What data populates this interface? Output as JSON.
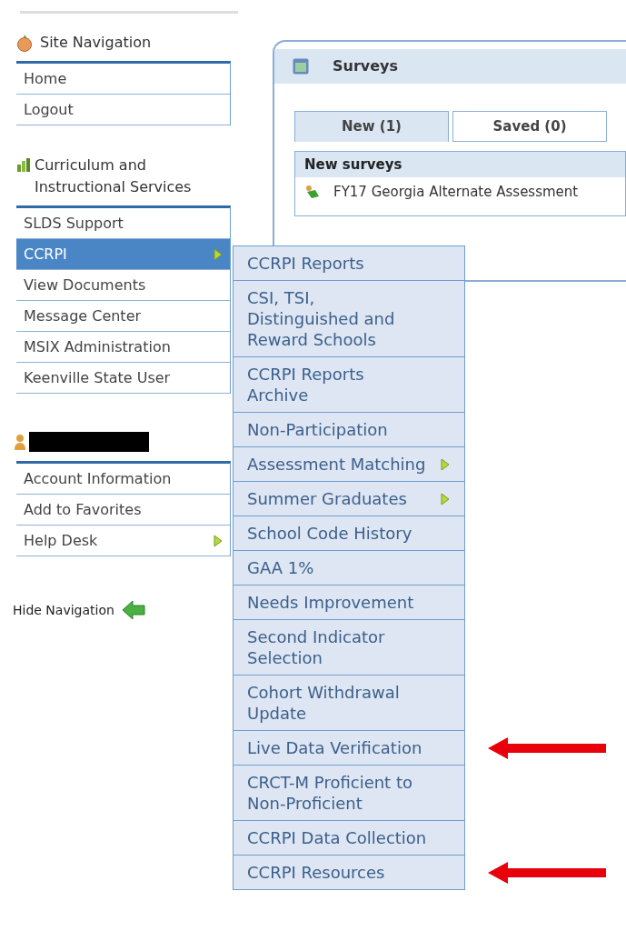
{
  "site_navigation": {
    "title": "Site Navigation",
    "items": [
      {
        "label": "Home",
        "selected": false,
        "has_submenu": false
      },
      {
        "label": "Logout",
        "selected": false,
        "has_submenu": false
      }
    ]
  },
  "services": {
    "title": "Curriculum and Instructional Services",
    "items": [
      {
        "label": "SLDS Support",
        "selected": false,
        "has_submenu": false
      },
      {
        "label": "CCRPI",
        "selected": true,
        "has_submenu": true
      },
      {
        "label": "View Documents",
        "selected": false,
        "has_submenu": false
      },
      {
        "label": "Message Center",
        "selected": false,
        "has_submenu": false
      },
      {
        "label": "MSIX Administration",
        "selected": false,
        "has_submenu": false
      },
      {
        "label": "Keenville State User",
        "selected": false,
        "has_submenu": false
      }
    ]
  },
  "user": {
    "items": [
      {
        "label": "Account Information",
        "selected": false,
        "has_submenu": false
      },
      {
        "label": "Add to Favorites",
        "selected": false,
        "has_submenu": false
      },
      {
        "label": "Help Desk",
        "selected": false,
        "has_submenu": true
      }
    ]
  },
  "hide_navigation": "Hide Navigation",
  "surveys": {
    "title": "Surveys",
    "tabs": [
      {
        "label": "New (1)",
        "selected": true
      },
      {
        "label": "Saved (0)",
        "selected": false
      }
    ],
    "section_title": "New surveys",
    "rows": [
      "FY17 Georgia Alternate Assessment"
    ]
  },
  "ccrpi_menu": [
    {
      "label": "CCRPI Reports",
      "has_submenu": false,
      "arrow": false
    },
    {
      "label": "CSI, TSI, Distinguished and Reward Schools",
      "has_submenu": false,
      "arrow": false
    },
    {
      "label": "CCRPI Reports Archive",
      "has_submenu": false,
      "arrow": false
    },
    {
      "label": "Non-Participation",
      "has_submenu": false,
      "arrow": false
    },
    {
      "label": "Assessment Matching",
      "has_submenu": true,
      "arrow": false
    },
    {
      "label": "Summer Graduates",
      "has_submenu": true,
      "arrow": false
    },
    {
      "label": "School Code History",
      "has_submenu": false,
      "arrow": false
    },
    {
      "label": "GAA 1%",
      "has_submenu": false,
      "arrow": false
    },
    {
      "label": "Needs Improvement",
      "has_submenu": false,
      "arrow": false
    },
    {
      "label": "Second Indicator Selection",
      "has_submenu": false,
      "arrow": false
    },
    {
      "label": "Cohort Withdrawal Update",
      "has_submenu": false,
      "arrow": false
    },
    {
      "label": "Live Data Verification",
      "has_submenu": false,
      "arrow": true
    },
    {
      "label": "CRCT-M Proficient to Non-Proficient",
      "has_submenu": false,
      "arrow": false
    },
    {
      "label": "CCRPI Data Collection",
      "has_submenu": false,
      "arrow": false
    },
    {
      "label": "CCRPI Resources",
      "has_submenu": false,
      "arrow": true
    }
  ]
}
